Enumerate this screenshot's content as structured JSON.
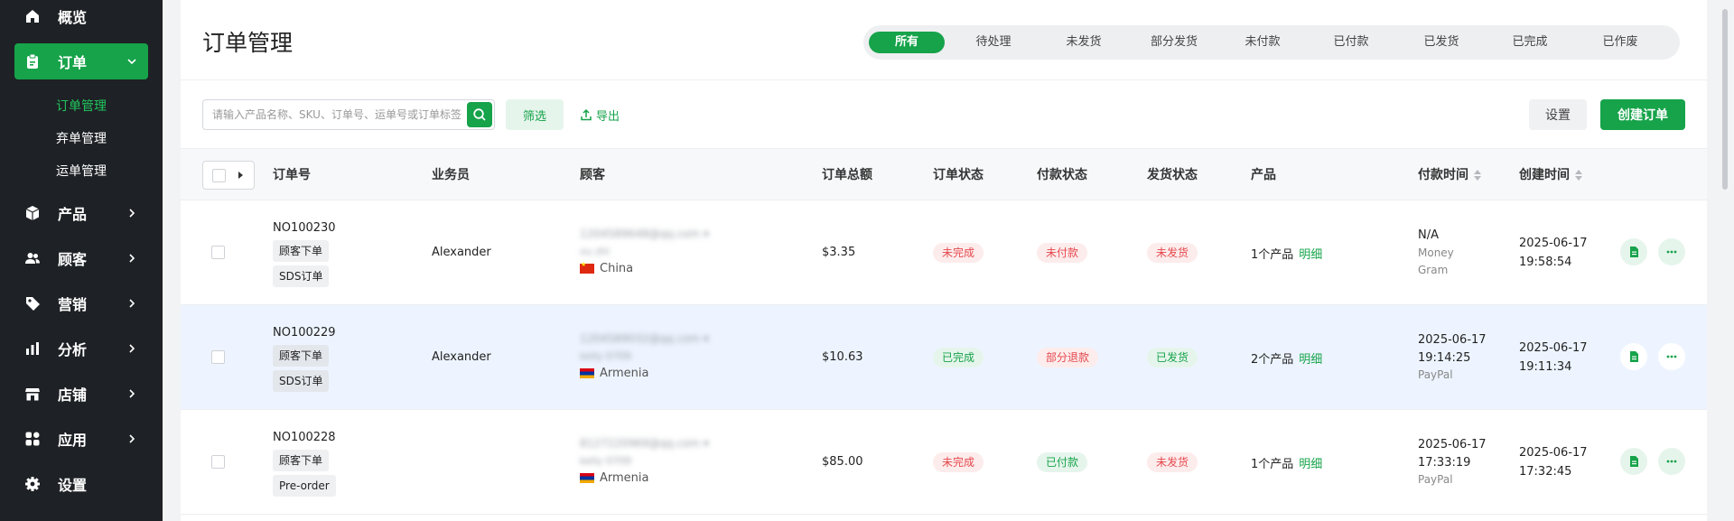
{
  "sidebar": {
    "items": [
      {
        "label": "概览",
        "icon": "home-icon"
      },
      {
        "label": "订单",
        "icon": "clipboard-icon"
      },
      {
        "label": "产品",
        "icon": "box-icon"
      },
      {
        "label": "顾客",
        "icon": "users-icon"
      },
      {
        "label": "营销",
        "icon": "tag-icon"
      },
      {
        "label": "分析",
        "icon": "bar-chart-icon"
      },
      {
        "label": "店铺",
        "icon": "store-icon"
      },
      {
        "label": "应用",
        "icon": "apps-icon"
      },
      {
        "label": "设置",
        "icon": "gear-icon"
      }
    ],
    "sub_items": [
      {
        "label": "订单管理"
      },
      {
        "label": "弃单管理"
      },
      {
        "label": "运单管理"
      }
    ]
  },
  "page": {
    "title": "订单管理"
  },
  "status_tabs": [
    "所有",
    "待处理",
    "未发货",
    "部分发货",
    "未付款",
    "已付款",
    "已发货",
    "已完成",
    "已作废"
  ],
  "toolbar": {
    "search_placeholder": "请输入产品名称、SKU、订单号、运单号或订单标签",
    "filter_label": "筛选",
    "export_label": "导出",
    "settings_label": "设置",
    "create_label": "创建订单"
  },
  "table": {
    "columns": [
      "订单号",
      "业务员",
      "顾客",
      "订单总额",
      "订单状态",
      "付款状态",
      "发货状态",
      "产品",
      "付款时间",
      "创建时间"
    ],
    "detail_label": "明细",
    "rows": [
      {
        "order_no": "NO100230",
        "tags": [
          "顾客下单",
          "SDS订单"
        ],
        "salesperson": "Alexander",
        "email": "1204589648@qq.com",
        "name": "xu zhi",
        "country": "China",
        "total": "$3.35",
        "order_status": "未完成",
        "payment_status": "未付款",
        "shipping_status": "未发货",
        "products": "1个产品",
        "pay_time": [
          "N/A"
        ],
        "pay_method": [
          "Money",
          "Gram"
        ],
        "created": [
          "2025-06-17",
          "19:58:54"
        ]
      },
      {
        "order_no": "NO100229",
        "tags": [
          "顾客下单",
          "SDS订单"
        ],
        "salesperson": "Alexander",
        "email": "1204589032@qq.com",
        "name": "kelly 0709",
        "country": "Armenia",
        "total": "$10.63",
        "order_status": "已完成",
        "payment_status": "部分退款",
        "shipping_status": "已发货",
        "products": "2个产品",
        "pay_time": [
          "2025-06-17",
          "19:14:25"
        ],
        "pay_method": [
          "PayPal"
        ],
        "created": [
          "2025-06-17",
          "19:11:34"
        ]
      },
      {
        "order_no": "NO100228",
        "tags": [
          "顾客下单",
          "Pre-order"
        ],
        "salesperson": "",
        "email": "8127220969@qq.com",
        "name": "kelly 0709",
        "country": "Armenia",
        "total": "$85.00",
        "order_status": "未完成",
        "payment_status": "已付款",
        "shipping_status": "未发货",
        "products": "1个产品",
        "pay_time": [
          "2025-06-17",
          "17:33:19"
        ],
        "pay_method": [
          "PayPal"
        ],
        "created": [
          "2025-06-17",
          "17:32:45"
        ]
      }
    ]
  },
  "colors": {
    "accent": "#16a34a",
    "sidebar_bg": "#1e2125",
    "red": "#e5484d",
    "row_highlight": "#edf4ff"
  }
}
